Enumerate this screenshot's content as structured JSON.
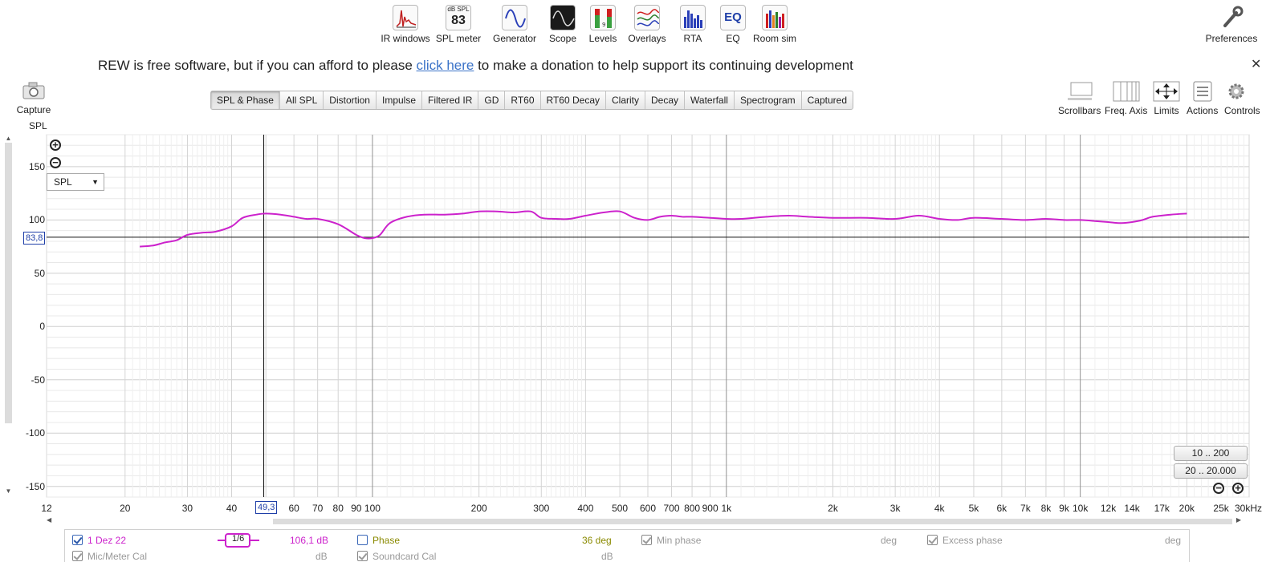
{
  "toolbar": {
    "items": [
      {
        "label": "IR windows"
      },
      {
        "label": "SPL meter",
        "value_top": "dB SPL",
        "value": "83"
      },
      {
        "label": "Generator"
      },
      {
        "label": "Scope"
      },
      {
        "label": "Levels"
      },
      {
        "label": "Overlays"
      },
      {
        "label": "RTA"
      },
      {
        "label": "EQ",
        "icon_text": "EQ"
      },
      {
        "label": "Room sim"
      }
    ],
    "preferences": "Preferences"
  },
  "banner": {
    "prefix": "REW is free software, but if you can afford to please ",
    "link": "click here",
    "suffix": " to make a donation to help support its continuing development"
  },
  "capture": {
    "label": "Capture"
  },
  "tabs": [
    "SPL & Phase",
    "All SPL",
    "Distortion",
    "Impulse",
    "Filtered IR",
    "GD",
    "RT60",
    "RT60 Decay",
    "Clarity",
    "Decay",
    "Waterfall",
    "Spectrogram",
    "Captured"
  ],
  "active_tab": 0,
  "right_tools": [
    "Scrollbars",
    "Freq. Axis",
    "Limits",
    "Actions",
    "Controls"
  ],
  "graph": {
    "y_axis_title": "SPL",
    "select_value": "SPL",
    "cursor_y": "83,8",
    "cursor_x": "49,3",
    "range_buttons": [
      "10 .. 200",
      "20 .. 20.000"
    ],
    "y_ticks": [
      "150",
      "100",
      "50",
      "0",
      "-50",
      "-100",
      "-150"
    ],
    "x_ticks": [
      "12",
      "20",
      "30",
      "40",
      "60",
      "70",
      "80",
      "90",
      "100",
      "200",
      "300",
      "400",
      "500",
      "600",
      "700",
      "800",
      "900",
      "1k",
      "2k",
      "3k",
      "4k",
      "5k",
      "6k",
      "7k",
      "8k",
      "9k",
      "10k",
      "12k",
      "14k",
      "17k",
      "20k",
      "25k",
      "30kHz"
    ]
  },
  "legend": {
    "measurement": "1 Dez 22",
    "smoothing": "1/6",
    "value": "106,1 dB",
    "phase": "Phase",
    "phase_value": "36 deg",
    "min_phase": "Min phase",
    "min_phase_unit": "deg",
    "excess_phase": "Excess phase",
    "excess_phase_unit": "deg",
    "mic_cal": "Mic/Meter Cal",
    "mic_cal_unit": "dB",
    "soundcard_cal": "Soundcard Cal",
    "soundcard_cal_unit": "dB"
  },
  "colors": {
    "trace": "#cc22cc",
    "phase": "#8a8a00",
    "cursor": "#1f3fa8"
  },
  "chart_data": {
    "type": "line",
    "xlabel": "",
    "ylabel": "SPL",
    "x_scale": "log",
    "xlim": [
      12,
      30000
    ],
    "ylim": [
      -160,
      180
    ],
    "grid": true,
    "series": [
      {
        "name": "1 Dez 22",
        "x": [
          22,
          24,
          26,
          28,
          30,
          33,
          36,
          40,
          43,
          47,
          50,
          55,
          60,
          65,
          70,
          80,
          90,
          95,
          100,
          105,
          112,
          125,
          140,
          160,
          180,
          200,
          225,
          250,
          280,
          300,
          330,
          360,
          400,
          450,
          500,
          550,
          600,
          650,
          700,
          750,
          800,
          900,
          1000,
          1100,
          1300,
          1500,
          1700,
          2000,
          2500,
          3000,
          3500,
          4000,
          4500,
          5000,
          6000,
          7000,
          8000,
          9000,
          10000,
          11000,
          12000,
          13000,
          14000,
          15000,
          16000,
          18000,
          20000
        ],
        "y": [
          75,
          76,
          79,
          81,
          86,
          88,
          89,
          94,
          102,
          105,
          106,
          105,
          103,
          101,
          101,
          96,
          86,
          83,
          83,
          86,
          97,
          103,
          105,
          105,
          106,
          108,
          108,
          107,
          108,
          102,
          101,
          101,
          104,
          107,
          108,
          102,
          100,
          103,
          104,
          103,
          103,
          102,
          101,
          101,
          103,
          104,
          103,
          102,
          102,
          101,
          104,
          101,
          100,
          102,
          101,
          100,
          101,
          100,
          100,
          99,
          98,
          97,
          98,
          100,
          103,
          105,
          106
        ]
      }
    ]
  }
}
